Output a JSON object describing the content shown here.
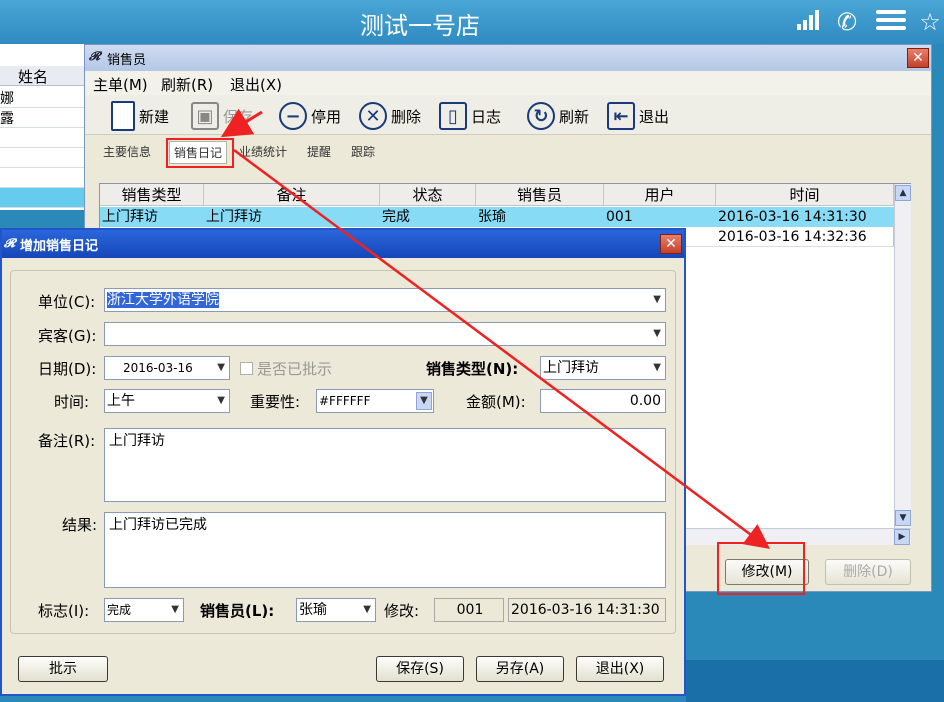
{
  "app": {
    "title": "测试一号店"
  },
  "bg_list": {
    "header": "姓名",
    "rows": [
      "娜",
      "露",
      "",
      "",
      "",
      ""
    ]
  },
  "sales_window": {
    "title": "销售员",
    "menu": [
      "主单(M)",
      "刷新(R)",
      "退出(X)"
    ],
    "toolbar": {
      "new": "新建",
      "save": "保存",
      "disable": "停用",
      "delete": "删除",
      "log": "日志",
      "refresh": "刷新",
      "exit": "退出"
    },
    "tabs": [
      "主要信息",
      "销售日记",
      "业绩统计",
      "提醒",
      "跟踪"
    ],
    "table": {
      "columns": [
        "销售类型",
        "备注",
        "状态",
        "销售员",
        "用户",
        "时间"
      ],
      "rows": [
        [
          "上门拜访",
          "上门拜访",
          "完成",
          "张瑜",
          "001",
          "2016-03-16 14:31:30"
        ],
        [
          "",
          "",
          "",
          "",
          "",
          "2016-03-16 14:32:36"
        ]
      ]
    },
    "buttons": {
      "modify": "修改(M)",
      "delete": "删除(D)"
    }
  },
  "dialog": {
    "title": "增加销售日记",
    "labels": {
      "unit": "单位(C):",
      "guest": "宾客(G):",
      "date": "日期(D):",
      "approved": "是否已批示",
      "sale_type": "销售类型(N):",
      "time": "时间:",
      "importance": "重要性:",
      "amount": "金额(M):",
      "remark": "备注(R):",
      "result": "结果:",
      "flag": "标志(I):",
      "salesperson": "销售员(L):",
      "modified": "修改:"
    },
    "values": {
      "unit": "浙江大学外语学院",
      "guest": "",
      "date": "2016-03-16",
      "sale_type": "上门拜访",
      "time": "上午",
      "importance": "#FFFFFF",
      "amount": "0.00",
      "remark": "上门拜访",
      "result": "上门拜访已完成",
      "flag": "完成",
      "salesperson": "张瑜",
      "modified_user": "001",
      "modified_time": "2016-03-16 14:31:30"
    },
    "buttons": {
      "approve": "批示",
      "save": "保存(S)",
      "save_as": "另存(A)",
      "exit": "退出(X)"
    }
  },
  "colors": {
    "annotation_red": "#ee2222",
    "selection_blue": "#88dbf5",
    "dialog_caption": "#2256c8"
  }
}
